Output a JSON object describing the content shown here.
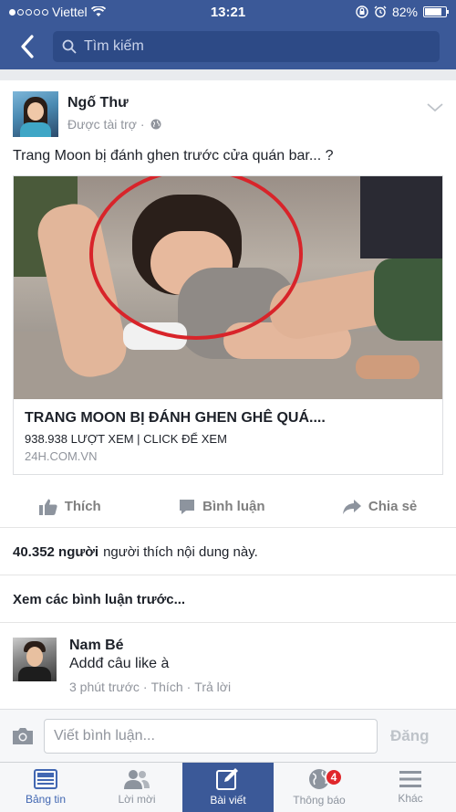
{
  "status_bar": {
    "carrier": "Viettel",
    "time": "13:21",
    "battery": "82%",
    "battery_level": 0.82
  },
  "nav": {
    "search_placeholder": "Tìm kiếm"
  },
  "post": {
    "author": "Ngố Thư",
    "sponsored": "Được tài trợ ·",
    "text": "Trang Moon bị đánh ghen trước cửa quán bar... ?",
    "link": {
      "title": "TRANG MOON BỊ ĐÁNH GHEN GHÊ QUÁ....",
      "description": "938.938 LƯỢT XEM | CLICK ĐỂ XEM",
      "domain": "24H.COM.VN"
    },
    "actions": {
      "like": "Thích",
      "comment": "Bình luận",
      "share": "Chia sẻ"
    },
    "likes_count": "40.352 người",
    "likes_text": "người thích nội dung này.",
    "view_previous": "Xem các bình luận trước..."
  },
  "comment": {
    "name": "Nam Bé",
    "text": "Addđ câu like à",
    "time": "3 phút trước",
    "like": "Thích",
    "reply": "Trả lời"
  },
  "composer": {
    "placeholder": "Viết bình luận...",
    "post_label": "Đăng"
  },
  "tabs": [
    {
      "label": "Bảng tin",
      "icon": "news-feed-icon"
    },
    {
      "label": "Lời mời",
      "icon": "friend-requests-icon"
    },
    {
      "label": "Bài viết",
      "icon": "compose-icon"
    },
    {
      "label": "Thông báo",
      "icon": "globe-icon",
      "badge": "4"
    },
    {
      "label": "Khác",
      "icon": "menu-icon"
    }
  ],
  "colors": {
    "brand": "#3b5998",
    "badge": "#e0272b",
    "selected_tab": "#3b5998"
  }
}
